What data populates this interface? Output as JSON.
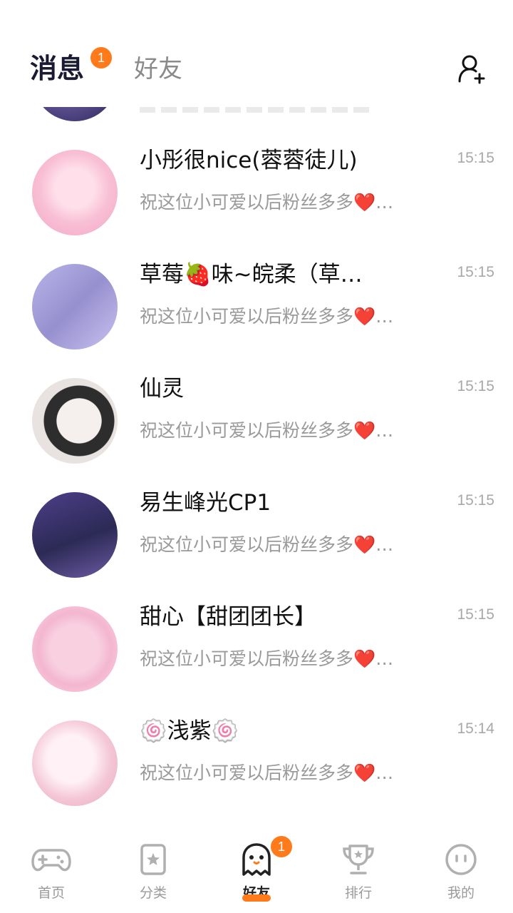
{
  "header": {
    "tabs": [
      {
        "label": "消息",
        "active": true,
        "badge": "1"
      },
      {
        "label": "好友",
        "active": false
      }
    ],
    "add_friend_icon": "add-user-icon"
  },
  "conversations": [
    {
      "name": "小彤很nice(蓉蓉徒儿)",
      "preview": "祝这位小可爱以后粉丝多多❤️…",
      "time": "15:15"
    },
    {
      "name": "草莓🍓味~皖柔（草…",
      "preview": "祝这位小可爱以后粉丝多多❤️…",
      "time": "15:15"
    },
    {
      "name": "仙灵",
      "preview": "祝这位小可爱以后粉丝多多❤️…",
      "time": "15:15"
    },
    {
      "name": "易生峰光CP1",
      "preview": "祝这位小可爱以后粉丝多多❤️…",
      "time": "15:15"
    },
    {
      "name": "甜心【甜团团长】",
      "preview": "祝这位小可爱以后粉丝多多❤️…",
      "time": "15:15"
    },
    {
      "name": "🍥浅紫🍥",
      "preview": "祝这位小可爱以后粉丝多多❤️…",
      "time": "15:14"
    }
  ],
  "tabbar": {
    "items": [
      {
        "label": "首页",
        "icon": "gamepad-icon"
      },
      {
        "label": "分类",
        "icon": "star-bookmark-icon"
      },
      {
        "label": "好友",
        "icon": "ghost-icon",
        "active": true,
        "badge": "1"
      },
      {
        "label": "排行",
        "icon": "trophy-icon"
      },
      {
        "label": "我的",
        "icon": "face-icon"
      }
    ]
  },
  "colors": {
    "accent": "#ff7a1a",
    "title": "#1a1a33",
    "muted": "#9a9a9a"
  }
}
